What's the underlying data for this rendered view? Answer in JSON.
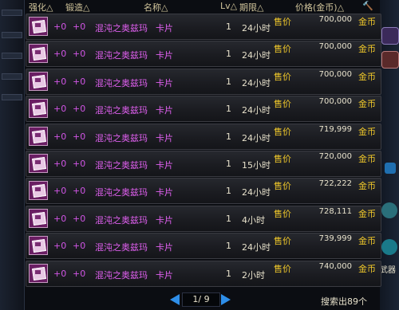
{
  "header": {
    "enhance": "强化△",
    "forge": "锻造△",
    "name": "名称△",
    "lv": "Lv△",
    "period": "期限△",
    "price": "价格(金币)△"
  },
  "sidebar": {
    "weapon_label": "武器"
  },
  "rows": [
    {
      "enhance": "+0",
      "forge": "+0",
      "name": "混沌之奥兹玛",
      "type": "卡片",
      "lv": "1",
      "period": "24小时",
      "sale": "售价",
      "price": "700,000",
      "unit": "金币"
    },
    {
      "enhance": "+0",
      "forge": "+0",
      "name": "混沌之奥兹玛",
      "type": "卡片",
      "lv": "1",
      "period": "24小时",
      "sale": "售价",
      "price": "700,000",
      "unit": "金币"
    },
    {
      "enhance": "+0",
      "forge": "+0",
      "name": "混沌之奥兹玛",
      "type": "卡片",
      "lv": "1",
      "period": "24小时",
      "sale": "售价",
      "price": "700,000",
      "unit": "金币"
    },
    {
      "enhance": "+0",
      "forge": "+0",
      "name": "混沌之奥兹玛",
      "type": "卡片",
      "lv": "1",
      "period": "24小时",
      "sale": "售价",
      "price": "700,000",
      "unit": "金币"
    },
    {
      "enhance": "+0",
      "forge": "+0",
      "name": "混沌之奥兹玛",
      "type": "卡片",
      "lv": "1",
      "period": "24小时",
      "sale": "售价",
      "price": "719,999",
      "unit": "金币"
    },
    {
      "enhance": "+0",
      "forge": "+0",
      "name": "混沌之奥兹玛",
      "type": "卡片",
      "lv": "1",
      "period": "15小时",
      "sale": "售价",
      "price": "720,000",
      "unit": "金币"
    },
    {
      "enhance": "+0",
      "forge": "+0",
      "name": "混沌之奥兹玛",
      "type": "卡片",
      "lv": "1",
      "period": "24小时",
      "sale": "售价",
      "price": "722,222",
      "unit": "金币"
    },
    {
      "enhance": "+0",
      "forge": "+0",
      "name": "混沌之奥兹玛",
      "type": "卡片",
      "lv": "1",
      "period": "4小时",
      "sale": "售价",
      "price": "728,111",
      "unit": "金币"
    },
    {
      "enhance": "+0",
      "forge": "+0",
      "name": "混沌之奥兹玛",
      "type": "卡片",
      "lv": "1",
      "period": "24小时",
      "sale": "售价",
      "price": "739,999",
      "unit": "金币"
    },
    {
      "enhance": "+0",
      "forge": "+0",
      "name": "混沌之奥兹玛",
      "type": "卡片",
      "lv": "1",
      "period": "2小时",
      "sale": "售价",
      "price": "740,000",
      "unit": "金币"
    }
  ],
  "pager": {
    "text": "1/ 9"
  },
  "search": {
    "result": "搜索出89个"
  },
  "colors": {
    "item_name": "#e060f0",
    "sale_label": "#f0c82a",
    "pager_arrow": "#2e8ee8"
  }
}
